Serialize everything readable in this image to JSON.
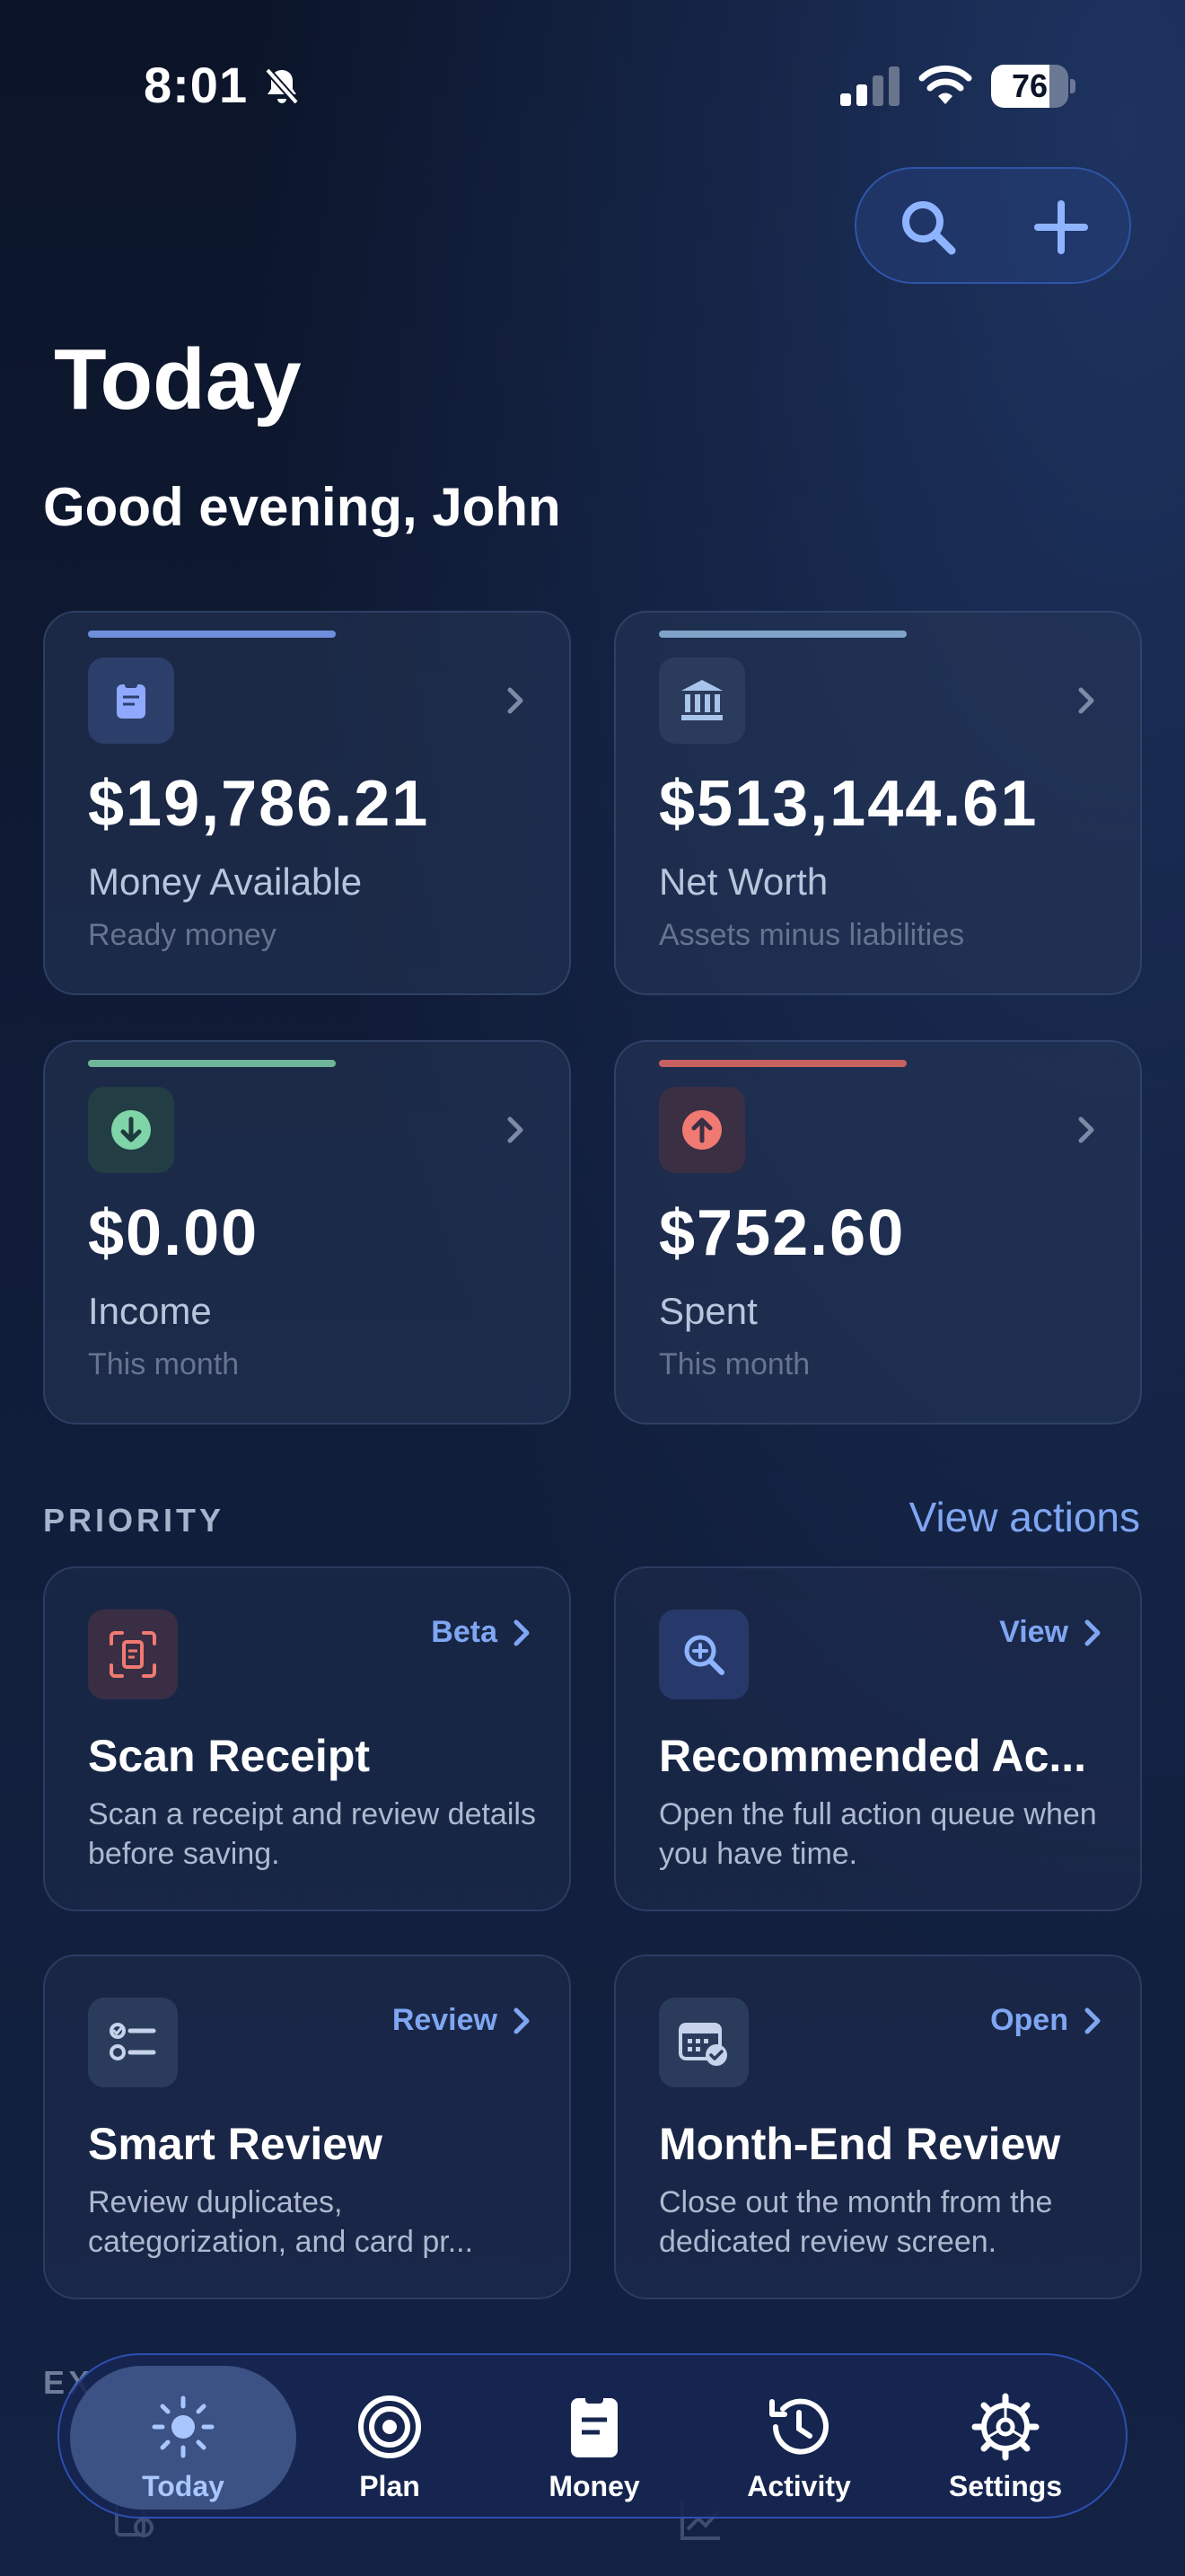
{
  "status_bar": {
    "time": "8:01",
    "battery": "76",
    "battery_level": 0.76
  },
  "header": {
    "title": "Today",
    "greeting": "Good evening, John"
  },
  "stats": [
    {
      "amount": "$19,786.21",
      "label": "Money Available",
      "sub": "Ready money",
      "icon": "clipboard-icon",
      "accent": "#6f8fdc"
    },
    {
      "amount": "$513,144.61",
      "label": "Net Worth",
      "sub": "Assets minus liabilities",
      "icon": "bank-icon",
      "accent": "#7fa3c9"
    },
    {
      "amount": "$0.00",
      "label": "Income",
      "sub": "This month",
      "icon": "arrow-down-circle-icon",
      "accent": "#6fb59a"
    },
    {
      "amount": "$752.60",
      "label": "Spent",
      "sub": "This month",
      "icon": "arrow-up-circle-icon",
      "accent": "#c7615f"
    }
  ],
  "priority": {
    "heading": "PRIORITY",
    "view_actions": "View actions",
    "cards": [
      {
        "title": "Scan Receipt",
        "tag": "Beta",
        "desc": "Scan a receipt and review details before saving.",
        "icon": "scan-receipt-icon"
      },
      {
        "title": "Recommended Ac...",
        "tag": "View",
        "desc": "Open the full action queue when you have time.",
        "icon": "magnify-plus-icon"
      },
      {
        "title": "Smart Review",
        "tag": "Review",
        "desc": "Review duplicates, categorization, and card pr...",
        "icon": "checklist-icon"
      },
      {
        "title": "Month-End Review",
        "tag": "Open",
        "desc": "Close out the month from the dedicated review screen.",
        "icon": "calendar-check-icon"
      }
    ]
  },
  "next_section": {
    "heading": "EX"
  },
  "tabs": [
    {
      "label": "Today",
      "icon": "sun-icon",
      "active": true
    },
    {
      "label": "Plan",
      "icon": "target-icon"
    },
    {
      "label": "Money",
      "icon": "clipboard-icon"
    },
    {
      "label": "Activity",
      "icon": "history-icon"
    },
    {
      "label": "Settings",
      "icon": "gear-icon"
    }
  ]
}
